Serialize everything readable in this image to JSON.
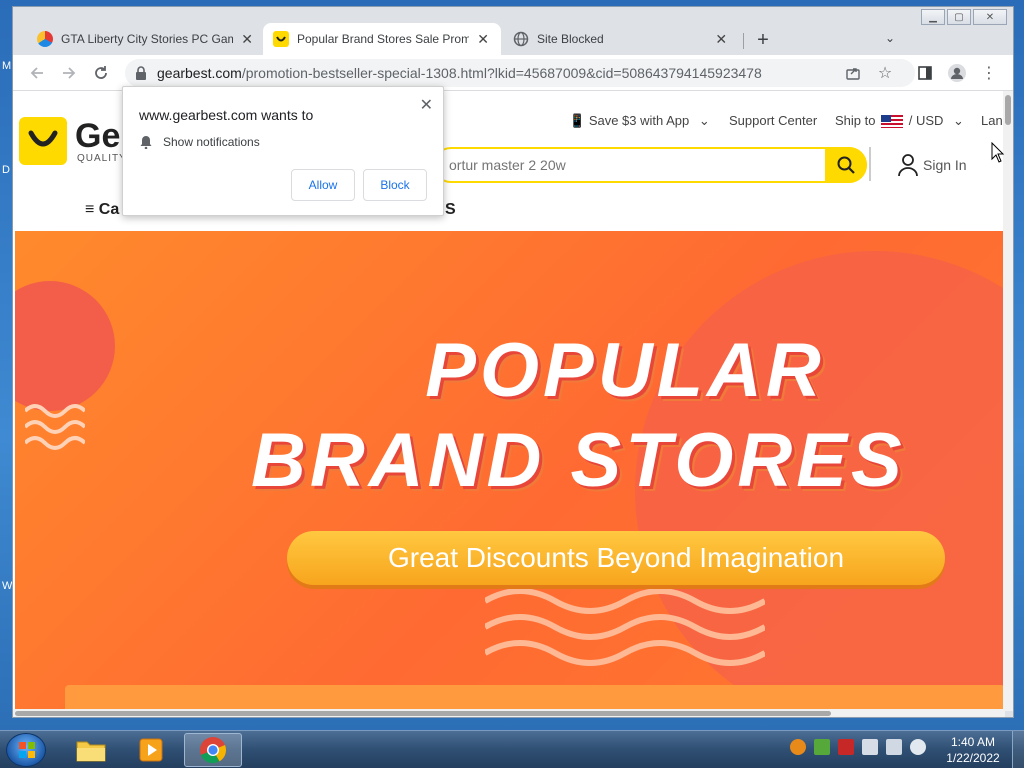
{
  "desktop": {
    "edge_letters": [
      "M",
      "D",
      "W"
    ]
  },
  "browser": {
    "tabs": [
      {
        "title": "GTA Liberty City Stories PC Game",
        "active": false
      },
      {
        "title": "Popular Brand Stores Sale Promo",
        "active": true
      },
      {
        "title": "Site Blocked",
        "active": false
      }
    ],
    "new_tab_label": "+",
    "tab_search_label": "⌄",
    "url_host": "gearbest.com",
    "url_path": "/promotion-bestseller-special-1308.html?lkid=45687009&cid=508643794145923478"
  },
  "site": {
    "logo_text": "Ge",
    "logo_sub": "QUALITY",
    "save_app": "Save $3 with App",
    "support_center": "Support Center",
    "ship_to": "Ship to",
    "currency": "/ USD",
    "language": "Lan",
    "search_placeholder": "ortur master 2 20w",
    "sign_in": "Sign In",
    "category": "≡ Ca",
    "nav_right": "S"
  },
  "banner": {
    "title_line1": "POPULAR",
    "title_line2": "BRAND STORES",
    "pill_text": "Great Discounts Beyond Imagination"
  },
  "permission_popup": {
    "title": "www.gearbest.com wants to",
    "item": "Show notifications",
    "allow": "Allow",
    "block": "Block"
  },
  "taskbar": {
    "time": "1:40 AM",
    "date": "1/22/2022"
  },
  "colors": {
    "brand_yellow": "#ffda00",
    "banner_orange": "#ff7a2e",
    "link_blue": "#1a73e8"
  }
}
